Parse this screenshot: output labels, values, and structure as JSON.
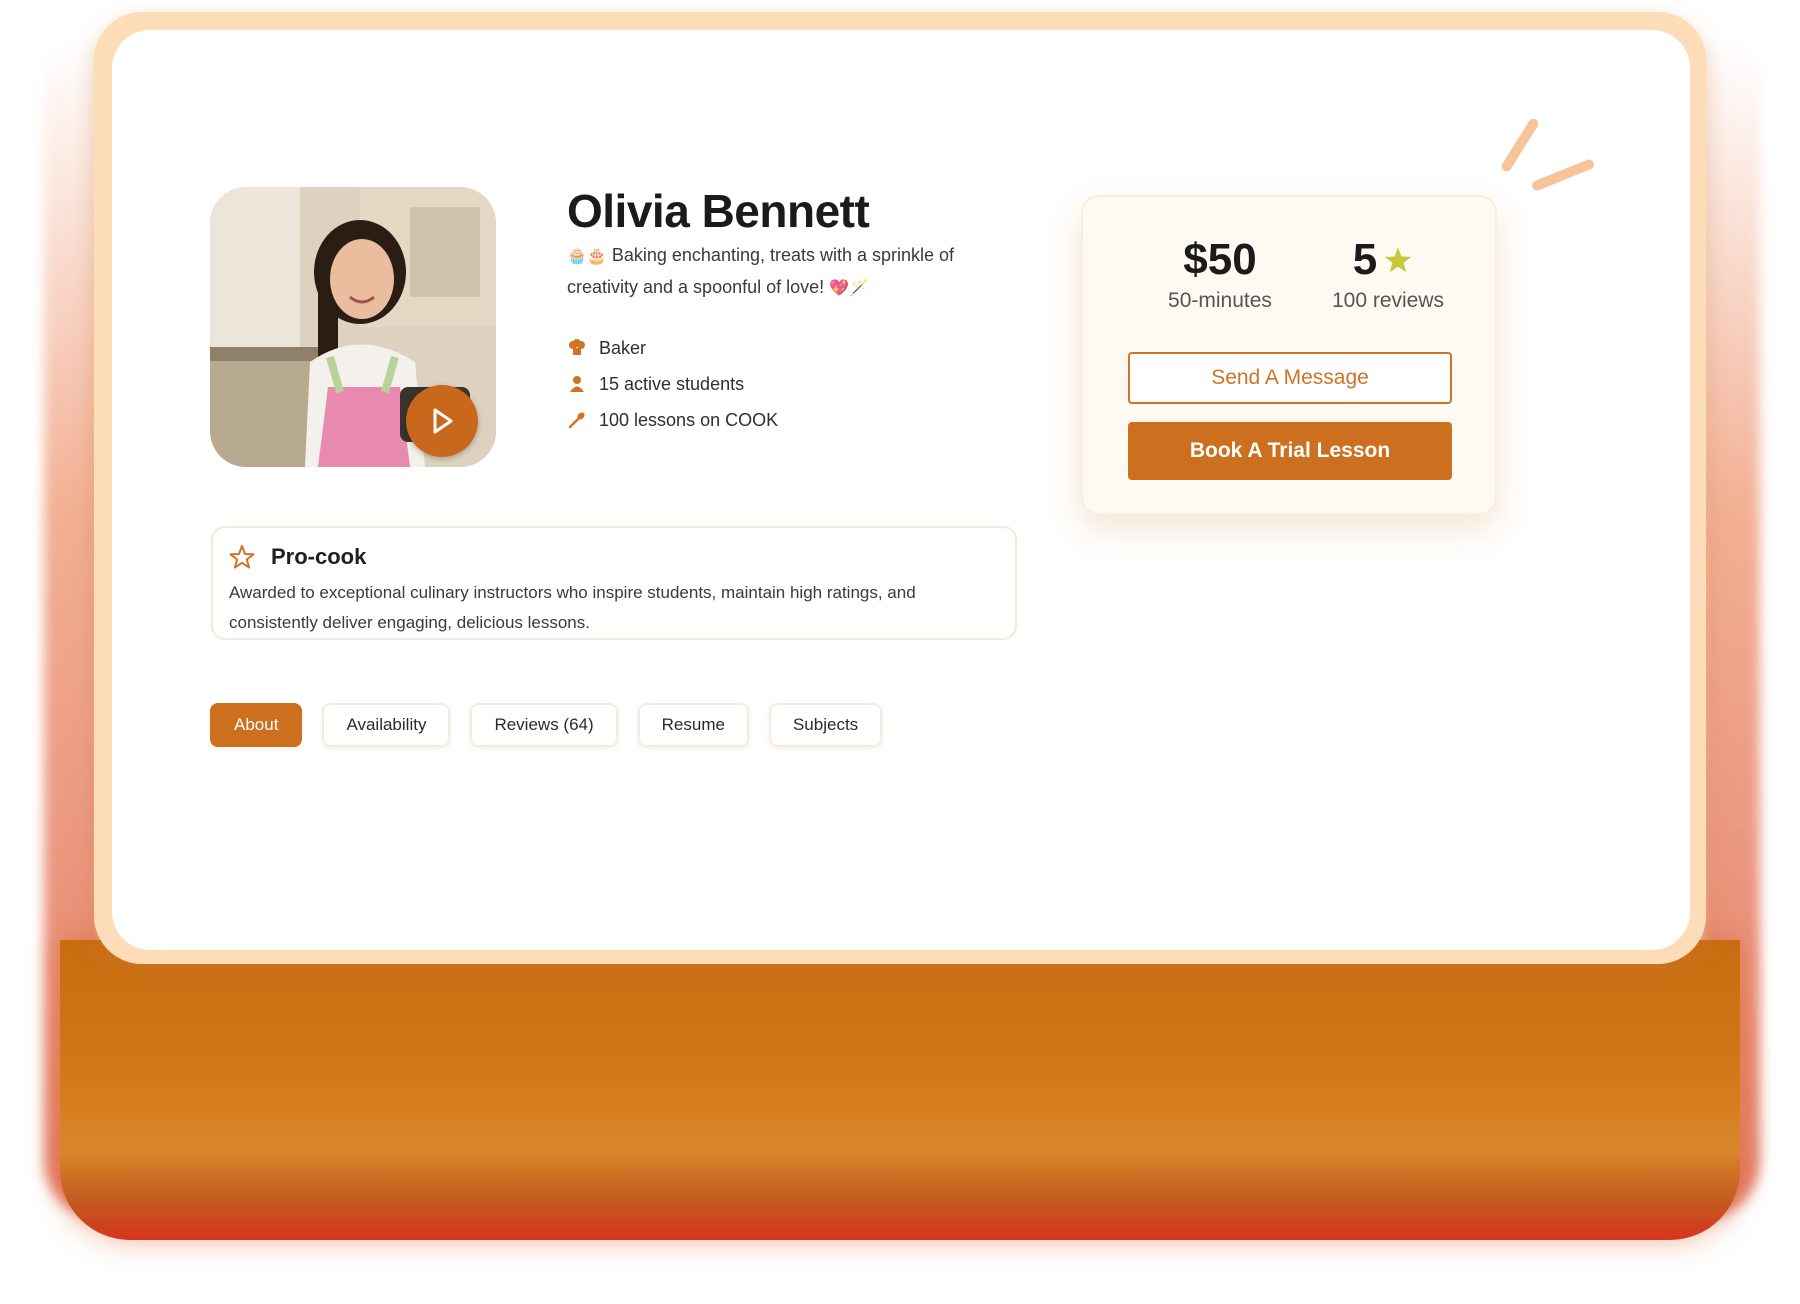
{
  "profile": {
    "name": "Olivia Bennett",
    "bio_prefix_emoji": "🧁🎂",
    "bio": "Baking enchanting, treats with a sprinkle of creativity and a spoonful of love!",
    "bio_suffix_emoji": "💖🪄",
    "facts": [
      {
        "icon": "chef-hat-icon",
        "label": "Baker"
      },
      {
        "icon": "user-icon",
        "label": "15 active students"
      },
      {
        "icon": "whisk-icon",
        "label": "100 lessons on COOK"
      }
    ],
    "photo_icon": "instructor-photo",
    "play_icon": "play-icon"
  },
  "badge": {
    "icon": "star-outline-icon",
    "title": "Pro-cook",
    "description": "Awarded to exceptional culinary instructors who inspire students, maintain high ratings, and consistently deliver engaging, delicious lessons."
  },
  "tabs": [
    {
      "label": "About",
      "active": true
    },
    {
      "label": "Availability",
      "active": false
    },
    {
      "label": "Reviews (64)",
      "active": false
    },
    {
      "label": "Resume",
      "active": false
    },
    {
      "label": "Subjects",
      "active": false
    }
  ],
  "pricing": {
    "price": "$50",
    "duration": "50-minutes",
    "rating": "5",
    "rating_icon": "star-icon",
    "reviews": "100 reviews",
    "message_button": "Send A Message",
    "book_button": "Book A Trial Lesson"
  },
  "colors": {
    "accent": "#cc6f1f",
    "frame": "#fddcb8",
    "star": "#c8c83a"
  }
}
